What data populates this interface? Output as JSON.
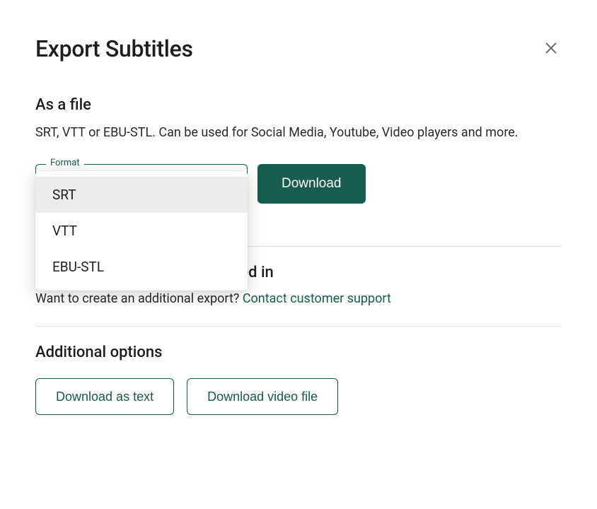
{
  "dialog": {
    "title": "Export Subtitles"
  },
  "file_section": {
    "heading": "As a file",
    "description": "SRT, VTT or EBU-STL. Can be used for Social Media, Youtube, Video players and more.",
    "format_label": "Format",
    "download_label": "Download",
    "options": [
      "SRT",
      "VTT",
      "EBU-STL"
    ],
    "selected": "SRT"
  },
  "burned_section": {
    "heading": "As a video with subtitles burned in",
    "description_prefix": "Want to create an additional export? ",
    "link_text": "Contact customer support"
  },
  "additional_section": {
    "heading": "Additional options",
    "download_text_label": "Download as text",
    "download_video_label": "Download video file"
  }
}
